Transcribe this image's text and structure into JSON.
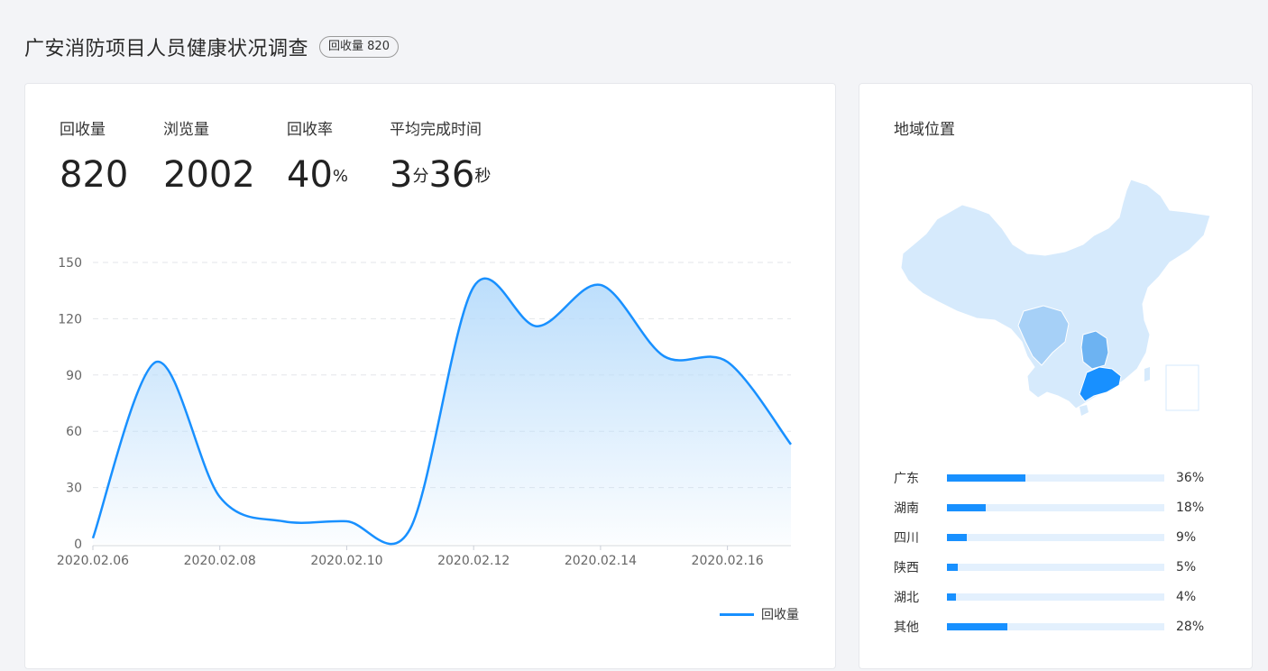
{
  "page": {
    "title": "广安消防项目人员健康状况调查",
    "badge": "回收量 820"
  },
  "stats": [
    {
      "label": "回收量",
      "value": "820"
    },
    {
      "label": "浏览量",
      "value": "2002"
    },
    {
      "label": "回收率",
      "value": "40",
      "unit": "%"
    },
    {
      "label": "平均完成时间",
      "min": "3",
      "min_unit": "分",
      "sec": "36",
      "sec_unit": "秒"
    }
  ],
  "chart_data": {
    "type": "area",
    "x": [
      "2020.02.06",
      "2020.02.07",
      "2020.02.08",
      "2020.02.09",
      "2020.02.10",
      "2020.02.11",
      "2020.02.12",
      "2020.02.13",
      "2020.02.14",
      "2020.02.15",
      "2020.02.16",
      "2020.02.17"
    ],
    "x_tick_labels": [
      "2020.02.06",
      "2020.02.08",
      "2020.02.10",
      "2020.02.12",
      "2020.02.14",
      "2020.02.16"
    ],
    "series": [
      {
        "name": "回收量",
        "values": [
          3,
          97,
          25,
          12,
          12,
          8,
          137,
          116,
          138,
          100,
          97,
          53
        ]
      }
    ],
    "y_ticks": [
      0,
      30,
      60,
      90,
      120,
      150
    ],
    "ylim": [
      0,
      150
    ],
    "grid": true,
    "legend": "bottom-right",
    "colors": {
      "line": "#1890ff",
      "fill": "#b8dcfb"
    }
  },
  "region": {
    "title": "地域位置",
    "items": [
      {
        "name": "广东",
        "pct": "36%",
        "value": 0.36
      },
      {
        "name": "湖南",
        "pct": "18%",
        "value": 0.18
      },
      {
        "name": "四川",
        "pct": "9%",
        "value": 0.09
      },
      {
        "name": "陕西",
        "pct": "5%",
        "value": 0.05
      },
      {
        "name": "湖北",
        "pct": "4%",
        "value": 0.04
      },
      {
        "name": "其他",
        "pct": "28%",
        "value": 0.28
      }
    ],
    "map_colors": {
      "base": "#d6eafc",
      "sichuan": "#a6d0f7",
      "hunan": "#6db3f2",
      "guangdong": "#1890ff"
    }
  }
}
